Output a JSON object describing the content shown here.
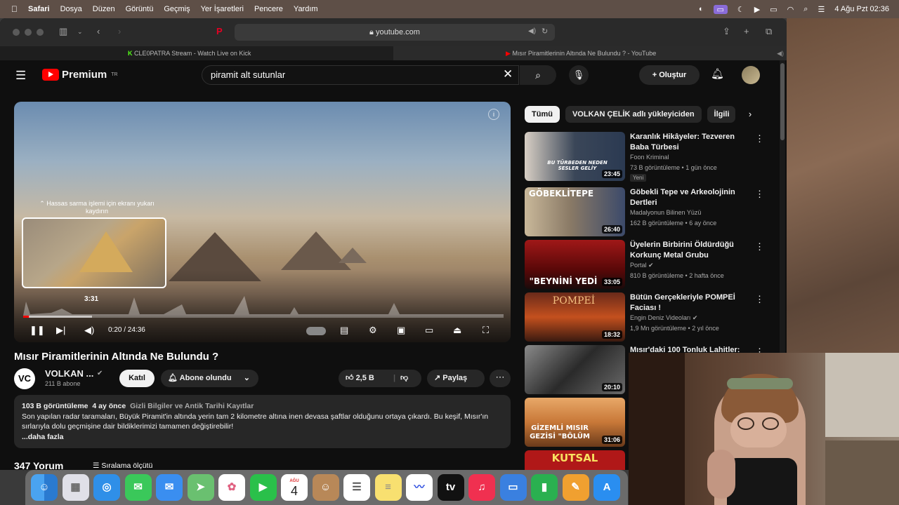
{
  "menubar": {
    "app": "Safari",
    "items": [
      "Dosya",
      "Düzen",
      "Görüntü",
      "Geçmiş",
      "Yer İşaretleri",
      "Pencere",
      "Yardım"
    ],
    "datetime": "4 Ağu Pzt  02:36"
  },
  "safari": {
    "url": "youtube.com",
    "tabs": [
      {
        "title": "CLE0PATRA Stream - Watch Live on Kick",
        "active": false
      },
      {
        "title": "Mısır Piramitlerinin Altında Ne Bulundu ? - YouTube",
        "active": true
      }
    ]
  },
  "youtube": {
    "logo_text": "Premium",
    "logo_sup": "TR",
    "search_value": "piramit alt sutunlar",
    "create_label": "Oluştur",
    "player": {
      "scrub_hint": "Hassas sarma işlemi için ekranı yukarı kaydırın",
      "preview_time": "3:31",
      "timecode": "0:20 / 24:36",
      "progress_fraction": 0.0136
    },
    "video": {
      "title": "Mısır Piramitlerinin Altında Ne Bulundu ?",
      "channel": "VOLKAN ...",
      "channel_initials": "VC",
      "subscribers": "211 B abone",
      "join_label": "Katıl",
      "subscribed_label": "Abone olundu",
      "likes": "2,5 B",
      "share_label": "Paylaş"
    },
    "description": {
      "views": "103 B görüntüleme",
      "age": "4 ay önce",
      "tags": "Gizli Bilgiler ve Antik Tarihi Kayıtlar",
      "text": "Son yapılan radar taramaları, Büyük Piramit'in altında yerin tam 2 kilometre altına inen devasa şaftlar olduğunu ortaya çıkardı. Bu keşif, Mısır'ın sırlarıyla dolu geçmişine dair bildiklerimizi tamamen değiştirebilir!",
      "more": "...daha fazla"
    },
    "comments": {
      "count_label": "347 Yorum",
      "sort_label": "Sıralama ölçütü"
    },
    "chips": [
      "Tümü",
      "VOLKAN ÇELİK adlı yükleyiciden",
      "İlgili"
    ],
    "recommendations": [
      {
        "title": "Karanlık Hikâyeler: Tezveren Baba Türbesi",
        "channel": "Foon Kriminal",
        "meta": "73 B görüntüleme • 1 gün önce",
        "badge": "Yeni",
        "duration": "23:45",
        "thumb_text": "BU TÜRBEDEN NEDEN SESLER GELİY"
      },
      {
        "title": "Göbekli Tepe ve Arkeolojinin Dertleri",
        "channel": "Madalyonun Bilinen Yüzü",
        "meta": "162 B görüntüleme • 6 ay önce",
        "badge": "",
        "duration": "26:40",
        "thumb_text": "GÖBEKLİTEPE"
      },
      {
        "title": "Üyelerin Birbirini Öldürdüğü Korkunç Metal Grubu",
        "channel": "Portal",
        "meta": "810 B görüntüleme • 2 hafta önce",
        "badge": "",
        "duration": "33:05",
        "thumb_text": "\"BEYNİNİ YEDİ"
      },
      {
        "title": "Bütün Gerçekleriyle POMPEİ Faciası !",
        "channel": "Engin Deniz Videoları",
        "meta": "1,9 Mn görüntüleme • 2 yıl önce",
        "badge": "",
        "duration": "18:32",
        "thumb_text": "POMPEİ"
      },
      {
        "title": "Mısır'daki 100 Tonluk Lahitler:",
        "channel": "",
        "meta": "",
        "badge": "",
        "duration": "20:10",
        "thumb_text": ""
      },
      {
        "title": "",
        "channel": "",
        "meta": "",
        "badge": "",
        "duration": "31:06",
        "thumb_text": "GİZEMLİ MISIR GEZİSİ \"BÖLÜM"
      },
      {
        "title": "",
        "channel": "",
        "meta": "",
        "badge": "",
        "duration": "",
        "thumb_text": "KUTSAL"
      }
    ]
  },
  "dock": {
    "calendar_month": "AĞU",
    "calendar_day": "4",
    "apps": [
      "finder-icon",
      "launchpad-icon",
      "safari-icon",
      "messages-icon",
      "mail-icon",
      "maps-icon",
      "photos-icon",
      "facetime-icon",
      "calendar-icon",
      "contacts-icon",
      "reminders-icon",
      "notes-icon",
      "freeform-icon",
      "tv-icon",
      "music-icon",
      "keynote-icon",
      "numbers-icon",
      "pages-icon",
      "appstore-icon"
    ]
  },
  "colors": {
    "yt_bg": "#0f0f0f",
    "yt_red": "#ff0000",
    "chip_bg": "#272727"
  }
}
